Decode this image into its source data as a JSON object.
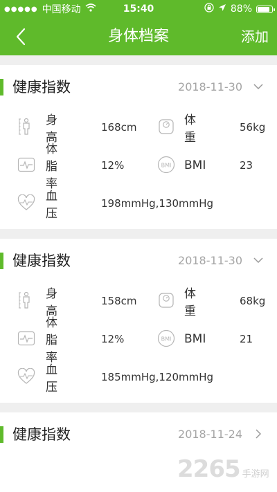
{
  "status_bar": {
    "carrier": "中国移动",
    "time": "15:40",
    "battery_text": "88%",
    "battery_level": 0.88
  },
  "nav": {
    "title": "身体档案",
    "add_label": "添加"
  },
  "records": [
    {
      "title": "健康指数",
      "date": "2018-11-30",
      "expanded": true,
      "height_label": "身高",
      "height_value": "168cm",
      "weight_label": "体重",
      "weight_value": "56kg",
      "bodyfat_label": "体脂率",
      "bodyfat_value": "12%",
      "bmi_label": "BMI",
      "bmi_value": "23",
      "bp_label": "血压",
      "bp_value": "198mmHg,130mmHg"
    },
    {
      "title": "健康指数",
      "date": "2018-11-30",
      "expanded": true,
      "height_label": "身高",
      "height_value": "158cm",
      "weight_label": "体重",
      "weight_value": "68kg",
      "bodyfat_label": "体脂率",
      "bodyfat_value": "12%",
      "bmi_label": "BMI",
      "bmi_value": "21",
      "bp_label": "血压",
      "bp_value": "185mmHg,120mmHg"
    },
    {
      "title": "健康指数",
      "date": "2018-11-24",
      "expanded": false
    }
  ],
  "watermark": {
    "number": "2265",
    "suffix": "手游网"
  },
  "colors": {
    "accent": "#5fba2b",
    "divider": "#efefef",
    "muted_text": "#a5a5a5",
    "icon_stroke": "#b5b5b5"
  },
  "icons": {
    "back": "chevron-left-icon",
    "expanded": "chevron-down-icon",
    "collapsed": "chevron-right-icon",
    "height": "person-height-icon",
    "weight": "scale-icon",
    "bodyfat": "heartbeat-monitor-icon",
    "bmi": "bmi-icon",
    "bp": "heart-pulse-icon"
  }
}
